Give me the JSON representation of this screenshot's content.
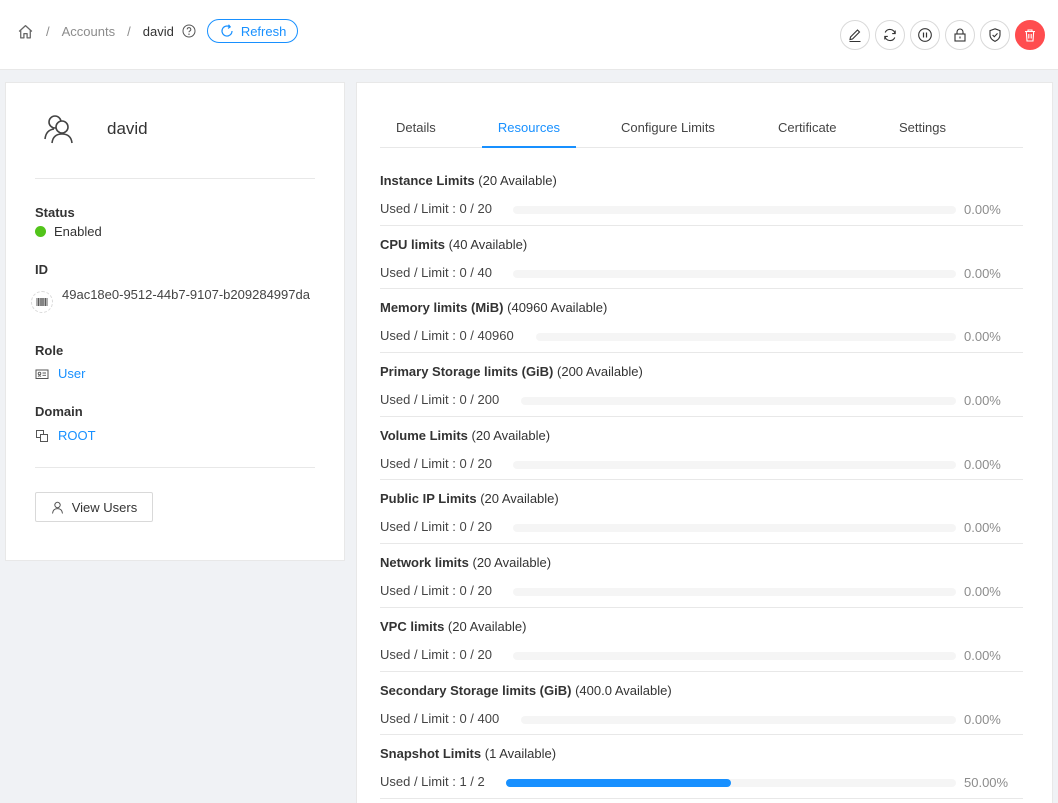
{
  "breadcrumb": {
    "home_icon": "home-icon",
    "accounts": "Accounts",
    "current": "david",
    "sep": "/"
  },
  "refresh_label": "Refresh",
  "actions": [
    "edit-icon",
    "sync-icon",
    "pause-icon",
    "lock-icon",
    "shield-check-icon",
    "delete-icon"
  ],
  "colors": {
    "accent": "#1890ff",
    "danger": "#ff4d4f",
    "enabled": "#52c41a"
  },
  "account": {
    "name": "david",
    "status_label": "Status",
    "status": "Enabled",
    "id_label": "ID",
    "id": "49ac18e0-9512-44b7-9107-b209284997da",
    "role_label": "Role",
    "role": "User",
    "domain_label": "Domain",
    "domain": "ROOT",
    "view_users": "View Users"
  },
  "tabs": [
    "Details",
    "Resources",
    "Configure Limits",
    "Certificate",
    "Settings"
  ],
  "active_tab": "Resources",
  "resources": [
    {
      "title": "Instance Limits",
      "available": "(20 Available)",
      "used": "Used / Limit : 0 / 20",
      "percent": "0.00%",
      "fraction": 0
    },
    {
      "title": "CPU limits",
      "available": "(40 Available)",
      "used": "Used / Limit : 0 / 40",
      "percent": "0.00%",
      "fraction": 0
    },
    {
      "title": "Memory limits (MiB)",
      "available": "(40960 Available)",
      "used": "Used / Limit : 0 / 40960",
      "percent": "0.00%",
      "fraction": 0
    },
    {
      "title": "Primary Storage limits (GiB)",
      "available": "(200 Available)",
      "used": "Used / Limit : 0 / 200",
      "percent": "0.00%",
      "fraction": 0
    },
    {
      "title": "Volume Limits",
      "available": "(20 Available)",
      "used": "Used / Limit : 0 / 20",
      "percent": "0.00%",
      "fraction": 0
    },
    {
      "title": "Public IP Limits",
      "available": "(20 Available)",
      "used": "Used / Limit : 0 / 20",
      "percent": "0.00%",
      "fraction": 0
    },
    {
      "title": "Network limits",
      "available": "(20 Available)",
      "used": "Used / Limit : 0 / 20",
      "percent": "0.00%",
      "fraction": 0
    },
    {
      "title": "VPC limits",
      "available": "(20 Available)",
      "used": "Used / Limit : 0 / 20",
      "percent": "0.00%",
      "fraction": 0
    },
    {
      "title": "Secondary Storage limits (GiB)",
      "available": "(400.0 Available)",
      "used": "Used / Limit : 0 / 400",
      "percent": "0.00%",
      "fraction": 0
    },
    {
      "title": "Snapshot Limits",
      "available": "(1 Available)",
      "used": "Used / Limit : 1 / 2",
      "percent": "50.00%",
      "fraction": 0.5
    }
  ]
}
